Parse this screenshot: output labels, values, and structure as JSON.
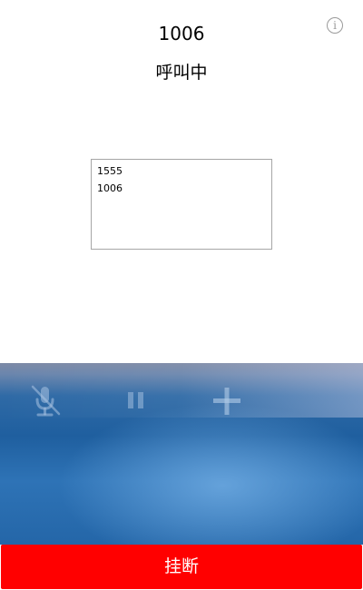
{
  "header": {
    "number": "1006",
    "status": "呼叫中",
    "info_symbol": "i"
  },
  "log": {
    "lines": [
      "1555",
      "1006"
    ]
  },
  "controls": {
    "mute_icon": "mute-mic-icon",
    "hold_icon": "pause-icon",
    "add_icon": "plus-icon"
  },
  "footer": {
    "hangup_label": "挂断",
    "hangup_color": "#ff0000"
  }
}
